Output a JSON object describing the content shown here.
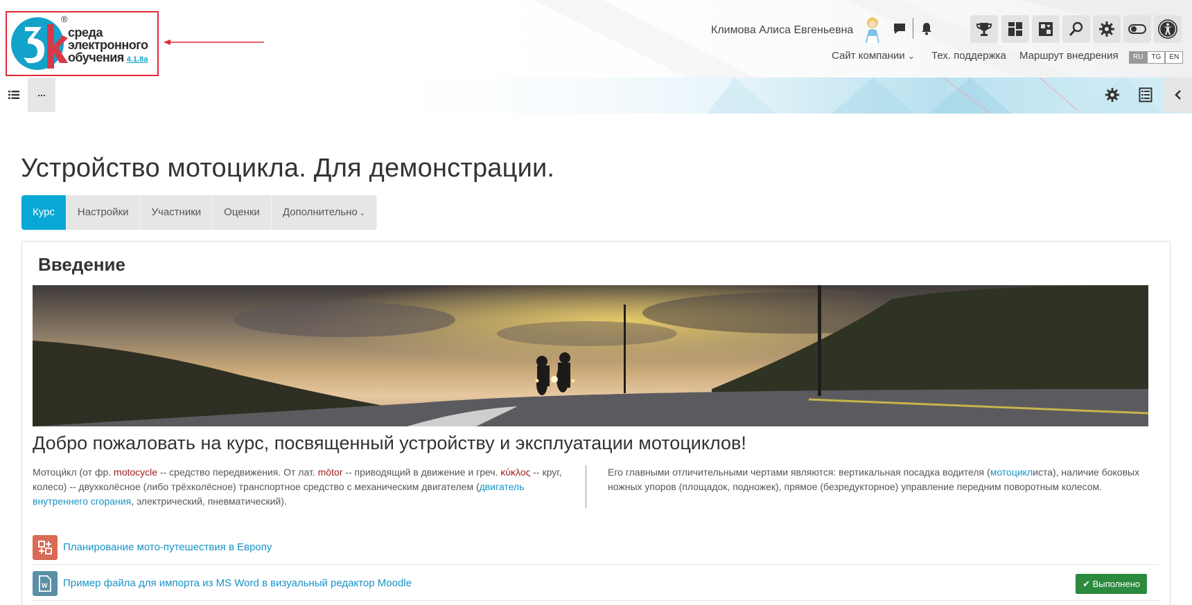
{
  "logo": {
    "line1": "среда",
    "line2": "электронного",
    "line3": "обучения",
    "version": "4.1.8a",
    "registered": "®",
    "mark_color": "#13a2c9",
    "accent_color": "#d8394a"
  },
  "header": {
    "user_name": "Климова Алиса Евгеньевна",
    "icons": [
      "chat-icon",
      "bell-icon",
      "trophy-icon",
      "dashboard-icon",
      "puzzle-icon",
      "search-icon",
      "gear-icon",
      "toggle-icon",
      "accessibility-icon"
    ],
    "nav": {
      "company_site": "Сайт компании",
      "company_caret": "⌄",
      "support": "Тех. поддержка",
      "route": "Маршрут внедрения"
    },
    "languages": [
      {
        "code": "RU",
        "active": true
      },
      {
        "code": "TG",
        "active": false
      },
      {
        "code": "EN",
        "active": false
      }
    ]
  },
  "subbar": {
    "more_label": "...",
    "icons": [
      "list-icon",
      "gear-icon",
      "report-icon",
      "chevron-left-icon"
    ]
  },
  "course": {
    "title": "Устройство мотоцикла. Для демонстрации.",
    "tabs": [
      {
        "label": "Курс",
        "active": true
      },
      {
        "label": "Настройки",
        "active": false
      },
      {
        "label": "Участники",
        "active": false
      },
      {
        "label": "Оценки",
        "active": false
      },
      {
        "label": "Дополнительно",
        "active": false
      }
    ],
    "tab_caret": "⌄",
    "section_title": "Введение",
    "welcome": "Добро пожаловать на курс, посвященный устройству и эксплуатации мотоциклов!",
    "left_text": {
      "p1": "Мотоци́кл (от фр. ",
      "w1": "motocycle",
      "p2": " -- средство передвижения. От лат. ",
      "w2": "mōtor",
      "p3": " -- приводящий в движение и греч. ",
      "w3": "κύκλος",
      "p4": " -- круг, колесо) -- двухколёсное (либо трёхколёсное) транспортное средство с механическим двигателем (",
      "link1": "двигатель внутреннего сгорания",
      "p5": ", электрический, пневматический)."
    },
    "right_text": {
      "p1": "Его главными отличительными чертами являются: вертикальная посадка водителя (",
      "link1": "мотоцикл",
      "p2": "иста), наличие боковых ножных упоров (площадок, подножек), прямое (безредукторное) управление передним поворотным колесом."
    },
    "activities": [
      {
        "title": "Планирование мото-путешествия в Европу",
        "icon": "workshop-icon",
        "icon_color": "#d96a55",
        "status": ""
      },
      {
        "title": "Пример файла для импорта из MS Word в визуальный редактор Moodle",
        "icon": "word-file-icon",
        "icon_color": "#5a8fa6",
        "status": "Выполнено"
      }
    ]
  },
  "colors": {
    "primary": "#08a8d6",
    "link": "#1793c7",
    "success": "#2c8a3f",
    "highlight_border": "#e32636"
  }
}
